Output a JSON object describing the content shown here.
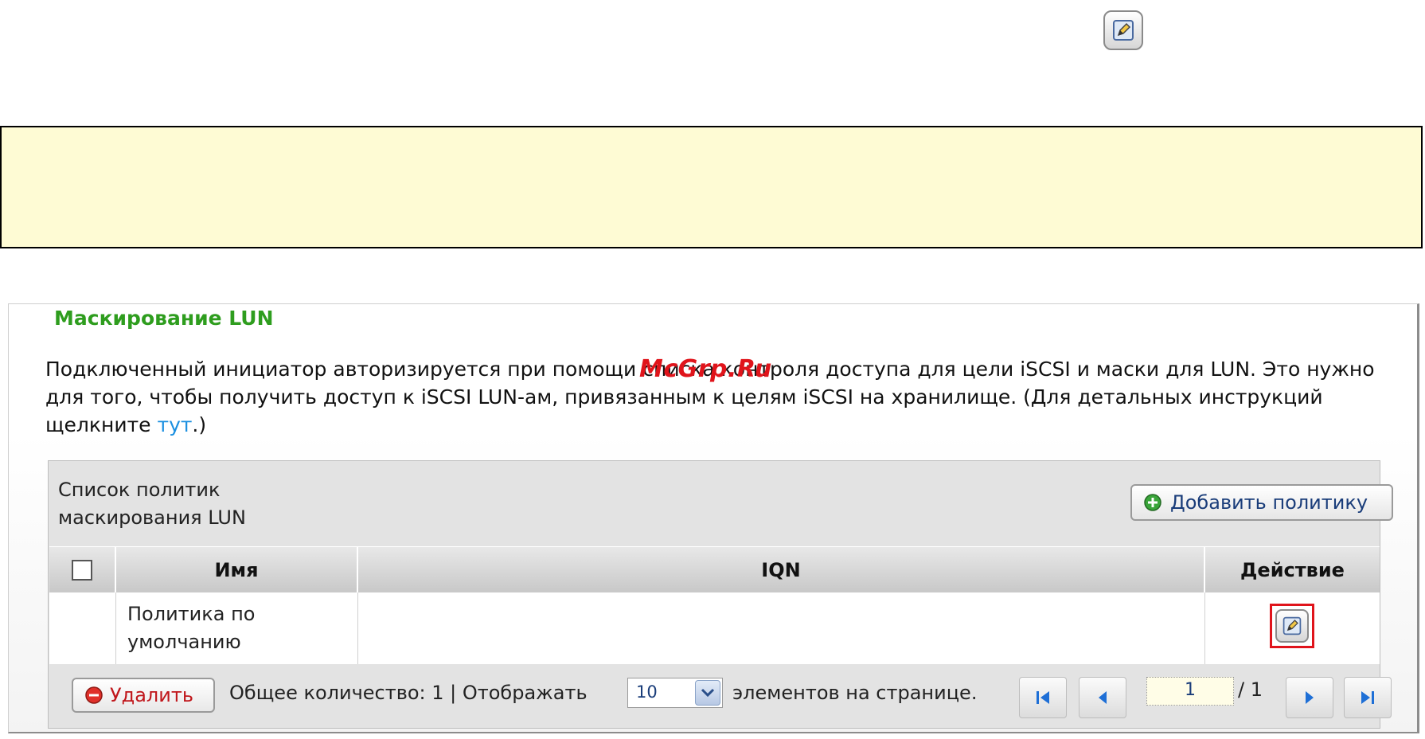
{
  "watermark": "McGrp.Ru",
  "section": {
    "legend": "Маскирование LUN",
    "description_part1": "Подключенный инициатор авторизируется при помощи списка контроля доступа для цели iSCSI и маски для LUN. Это нужно для того, чтобы получить доступ к iSCSI LUN-ам, привязанным к целям iSCSI на хранилище. (Для детальных инструкций щелкните ",
    "link_text": "тут",
    "description_part2": ".)"
  },
  "list": {
    "title_line1": "Список политик",
    "title_line2": "маскирования LUN",
    "add_button_label": "Добавить политику"
  },
  "table": {
    "columns": [
      "",
      "Имя",
      "IQN",
      "Действие"
    ],
    "rows": [
      {
        "name_line1": "Политика по",
        "name_line2": "умолчанию",
        "iqn": ""
      }
    ]
  },
  "footer": {
    "delete_label": "Удалить",
    "total_text": "Общее количество: 1  |  Отображать",
    "per_page_value": "10",
    "per_page_suffix": "элементов на странице.",
    "current_page": "1",
    "total_pages": "/ 1"
  },
  "colors": {
    "legend": "#2e9d1e",
    "link": "#1a8fe0",
    "note_bg": "#fefbd4",
    "highlight": "#e0141b"
  },
  "icons": [
    "edit-icon",
    "plus-circle-icon",
    "minus-circle-icon",
    "first-page-icon",
    "prev-page-icon",
    "next-page-icon",
    "last-page-icon",
    "chevron-down-icon"
  ]
}
